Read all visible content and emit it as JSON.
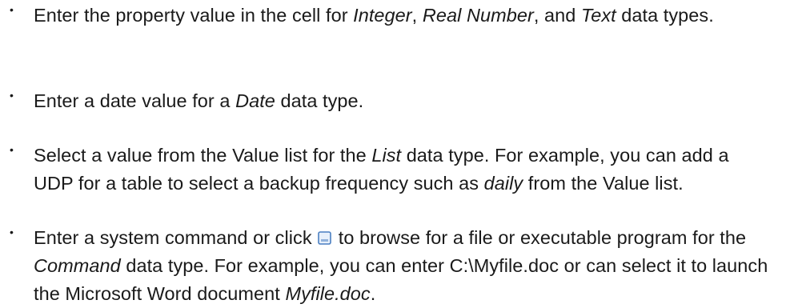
{
  "bullet_symbol": "•",
  "items": [
    {
      "t1": "Enter the property value in the cell for ",
      "e1": "Integer",
      "t2": ", ",
      "e2": "Real Number",
      "t3": ", and ",
      "e3": "Text",
      "t4": " data types."
    },
    {
      "t1": "Enter a date value for a ",
      "e1": "Date",
      "t2": " data type."
    },
    {
      "t1": "Select a value from the Value list for the ",
      "e1": "List",
      "t2": " data type. For example, you can add a UDP for a table to select a backup frequency such as ",
      "e2": "daily",
      "t3": " from the Value list."
    },
    {
      "t1": "Enter a system command or click ",
      "icon": "browse-icon",
      "t2": " to browse for a file or executable program for the ",
      "e1": "Command",
      "t3": " data type. For example, you can enter C:\\Myfile.doc or can select it to launch the Microsoft Word document ",
      "e2": "Myfile.doc",
      "t4": "."
    }
  ],
  "colors": {
    "text": "#1a1a1a",
    "icon_border": "#4a7fc1",
    "icon_fill": "#e8f0fb"
  }
}
